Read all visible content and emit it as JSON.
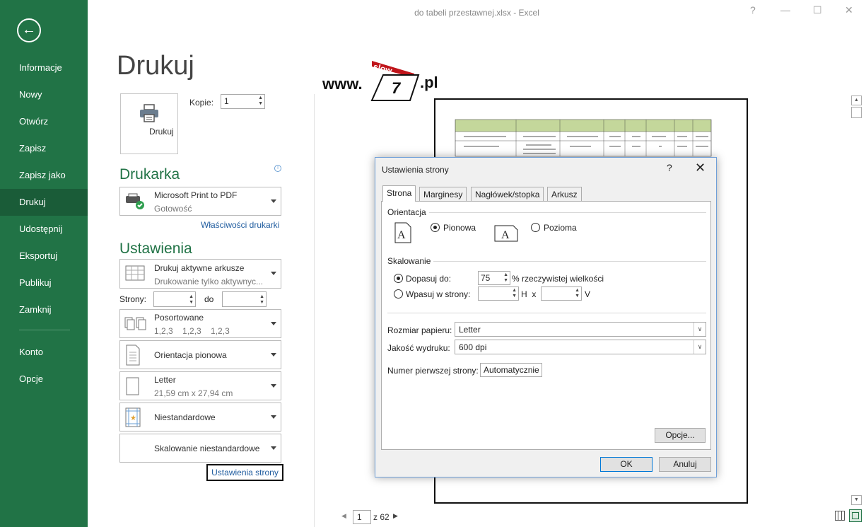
{
  "window": {
    "title": "do tabeli przestawnej.xlsx - Excel",
    "help": "?",
    "minimize": "—",
    "maximize": "☐",
    "close": "✕"
  },
  "sidebar": {
    "back": "←",
    "items": [
      {
        "label": "Informacje"
      },
      {
        "label": "Nowy"
      },
      {
        "label": "Otwórz"
      },
      {
        "label": "Zapisz"
      },
      {
        "label": "Zapisz jako"
      },
      {
        "label": "Drukuj",
        "active": true
      },
      {
        "label": "Udostępnij"
      },
      {
        "label": "Eksportuj"
      },
      {
        "label": "Publikuj"
      },
      {
        "label": "Zamknij"
      },
      {
        "label": "Konto"
      },
      {
        "label": "Opcje"
      }
    ]
  },
  "print": {
    "title": "Drukuj",
    "button_label": "Drukuj",
    "copies_label": "Kopie:",
    "copies_value": "1",
    "printer_heading": "Drukarka",
    "info_glyph": "i",
    "printer_name": "Microsoft Print to PDF",
    "printer_status": "Gotowość",
    "printer_properties_link": "Właściwości drukarki",
    "settings_heading": "Ustawienia",
    "settings": {
      "scope_main": "Drukuj aktywne arkusze",
      "scope_sub": "Drukowanie tylko aktywnyc...",
      "pages_label": "Strony:",
      "pages_to": "do",
      "collate_main": "Posortowane",
      "collate_sub": "1,2,3    1,2,3    1,2,3",
      "orientation": "Orientacja pionowa",
      "paper_main": "Letter",
      "paper_sub": "21,59  cm x 27,94  cm",
      "margins": "Niestandardowe",
      "scaling": "Skalowanie niestandardowe"
    },
    "page_setup_link": "Ustawienia strony"
  },
  "preview": {
    "logo_prefix": "www.",
    "logo_tag": "slow",
    "logo_num": "7",
    "logo_suffix": ".pl",
    "current_page": "1",
    "page_of": "z 62"
  },
  "dialog": {
    "title": "Ustawienia strony",
    "help": "?",
    "close": "✕",
    "tabs": [
      "Strona",
      "Marginesy",
      "Nagłówek/stopka",
      "Arkusz"
    ],
    "orientation_group": "Orientacja",
    "portrait": "Pionowa",
    "landscape": "Pozioma",
    "scaling_group": "Skalowanie",
    "adjust_to": "Dopasuj do:",
    "adjust_value": "75",
    "adjust_suffix": "% rzeczywistej wielkości",
    "fit_to": "Wpasuj w strony:",
    "fit_h": "H  x",
    "fit_v": "V",
    "paper_size_label": "Rozmiar papieru:",
    "paper_size_value": "Letter",
    "quality_label": "Jakość wydruku:",
    "quality_value": "600 dpi",
    "first_page_label": "Numer pierwszej strony:",
    "first_page_value": "Automatycznie",
    "options_button": "Opcje...",
    "ok_button": "OK",
    "cancel_button": "Anuluj"
  }
}
